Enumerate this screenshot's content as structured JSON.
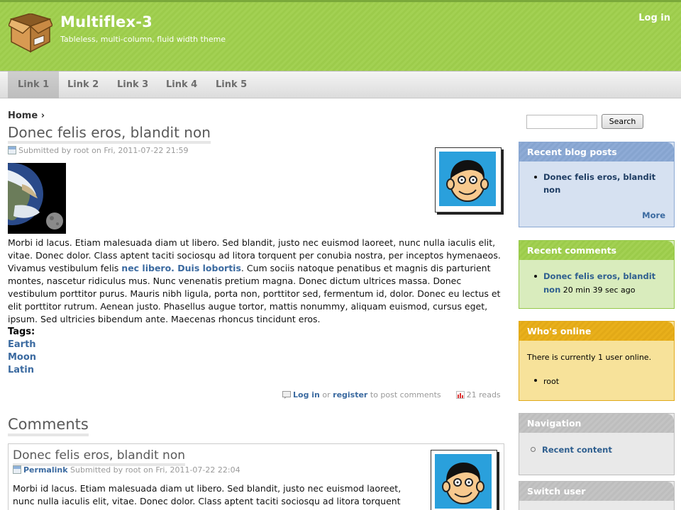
{
  "header": {
    "site_name": "Multiflex-3",
    "slogan": "Tableless, multi-column, fluid width theme",
    "login_label": "Log in",
    "logo_icon": "box-icon"
  },
  "nav": {
    "items": [
      {
        "label": "Link 1",
        "active": true
      },
      {
        "label": "Link 2",
        "active": false
      },
      {
        "label": "Link 3",
        "active": false
      },
      {
        "label": "Link 4",
        "active": false
      },
      {
        "label": "Link 5",
        "active": false
      }
    ]
  },
  "breadcrumb": {
    "home": "Home",
    "separator": "›"
  },
  "node": {
    "title": "Donec felis eros, blandit non",
    "submitted": "Submitted by root on Fri, 2011-07-22 21:59",
    "body_part1": "Morbi id lacus. Etiam malesuada diam ut libero. Sed blandit, justo nec euismod laoreet, nunc nulla iaculis elit, vitae. Donec dolor. Class aptent taciti sociosqu ad litora torquent per conubia nostra, per inceptos hymenaeos. Vivamus vestibulum felis ",
    "body_link": "nec libero. Duis lobortis",
    "body_part2": ". Cum sociis natoque penatibus et magnis dis parturient montes, nascetur ridiculus mus. Nunc venenatis pretium magna. Donec dictum ultrices massa. Donec vestibulum porttitor purus. Mauris nibh ligula, porta non, porttitor sed, fermentum id, dolor. Donec eu lectus et elit porttitor rutrum. Aenean justo. Phasellus augue tortor, mattis nonummy, aliquam euismod, cursus eget, ipsum. Sed ultricies bibendum ante. Maecenas rhoncus tincidunt eros.",
    "tags_label": "Tags:",
    "tags": [
      "Earth",
      "Moon",
      "Latin"
    ],
    "links": {
      "login": "Log in",
      "or": "or",
      "register": "register",
      "to_post": "to post comments",
      "reads": "21 reads"
    }
  },
  "comments": {
    "heading": "Comments",
    "items": [
      {
        "title": "Donec felis eros, blandit non",
        "permalink": "Permalink",
        "submitted": "Submitted by root on Fri, 2011-07-22 22:04",
        "text": "Morbi id lacus. Etiam malesuada diam ut libero. Sed blandit, justo nec euismod laoreet, nunc nulla iaculis elit, vitae. Donec dolor. Class aptent taciti sociosqu ad litora torquent per conubia"
      }
    ]
  },
  "sidebar": {
    "search_button": "Search",
    "search_value": "",
    "recent_posts": {
      "title": "Recent blog posts",
      "items": [
        "Donec felis eros, blandit non"
      ],
      "more": "More"
    },
    "recent_comments": {
      "title": "Recent comments",
      "items": [
        {
          "link": "Donec felis eros, blandit non",
          "time": "20 min 39 sec ago"
        }
      ]
    },
    "whos_online": {
      "title": "Who's online",
      "text": "There is currently 1 user online.",
      "users": [
        "root"
      ]
    },
    "navigation": {
      "title": "Navigation",
      "items": [
        "Recent content"
      ]
    },
    "switch_user": {
      "title": "Switch user"
    }
  },
  "colors": {
    "accent_green": "#a3d153",
    "link_blue": "#3b6aa0",
    "block_blue": "#8eabd6",
    "block_orange": "#e9b01b"
  }
}
